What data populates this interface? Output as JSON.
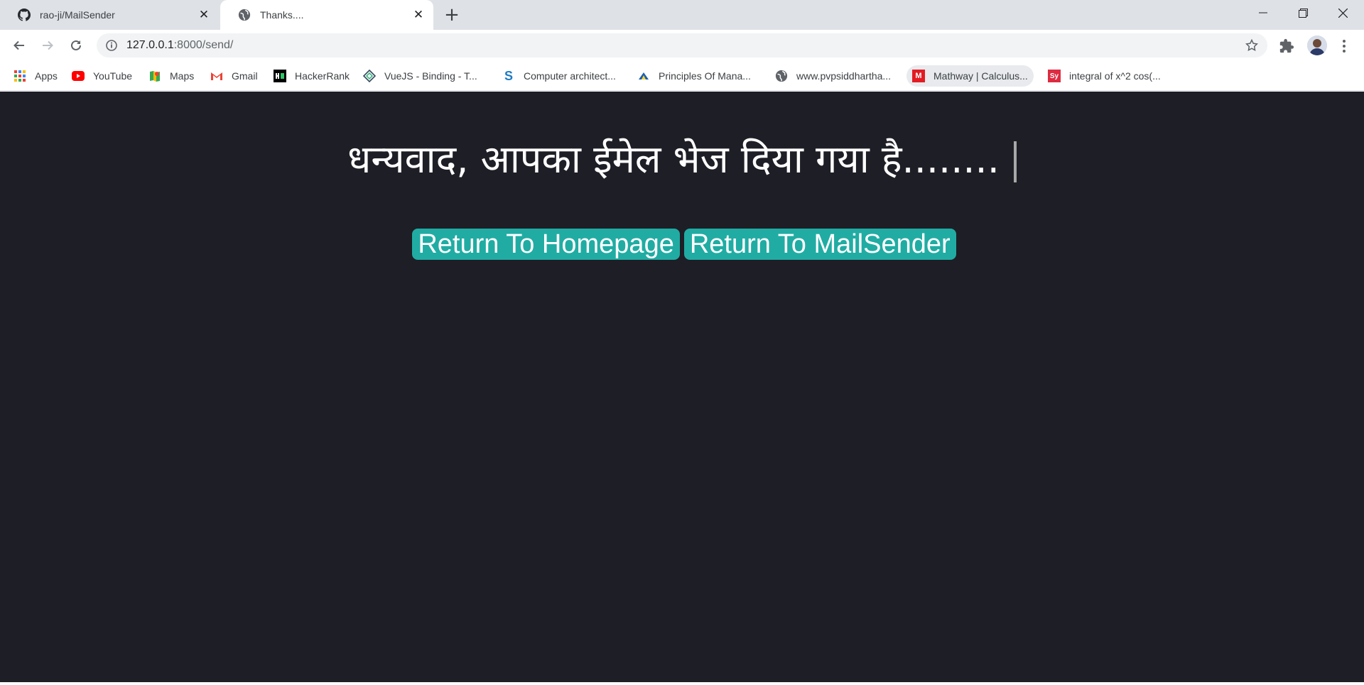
{
  "tabs": [
    {
      "title": "rao-ji/MailSender",
      "icon": "github-icon",
      "active": false
    },
    {
      "title": "Thanks....",
      "icon": "globe-icon",
      "active": true
    }
  ],
  "address_bar": {
    "host": "127.0.0.1",
    "path": ":8000/send/"
  },
  "bookmarks": [
    {
      "label": "Apps",
      "icon": "apps-grid-icon"
    },
    {
      "label": "YouTube",
      "icon": "youtube-icon"
    },
    {
      "label": "Maps",
      "icon": "maps-icon"
    },
    {
      "label": "Gmail",
      "icon": "gmail-icon"
    },
    {
      "label": "HackerRank",
      "icon": "hackerrank-icon"
    },
    {
      "label": "VueJS - Binding - T...",
      "icon": "vuejs-icon"
    },
    {
      "label": "Computer architect...",
      "icon": "scribd-icon"
    },
    {
      "label": "Principles Of Mana...",
      "icon": "principles-icon"
    },
    {
      "label": "www.pvpsiddhartha...",
      "icon": "globe-icon"
    },
    {
      "label": "Mathway | Calculus...",
      "icon": "mathway-icon"
    },
    {
      "label": "integral of x^2 cos(...",
      "icon": "symbolab-icon"
    }
  ],
  "page": {
    "heading": "धन्यवाद, आपका ईमेल भेज दिया गया है........",
    "buttons": {
      "home": "Return To Homepage",
      "mailsender": "Return To MailSender"
    }
  },
  "colors": {
    "page_background": "#1e1e26",
    "button_background": "#20aca3",
    "heading_text": "#ffffff"
  }
}
